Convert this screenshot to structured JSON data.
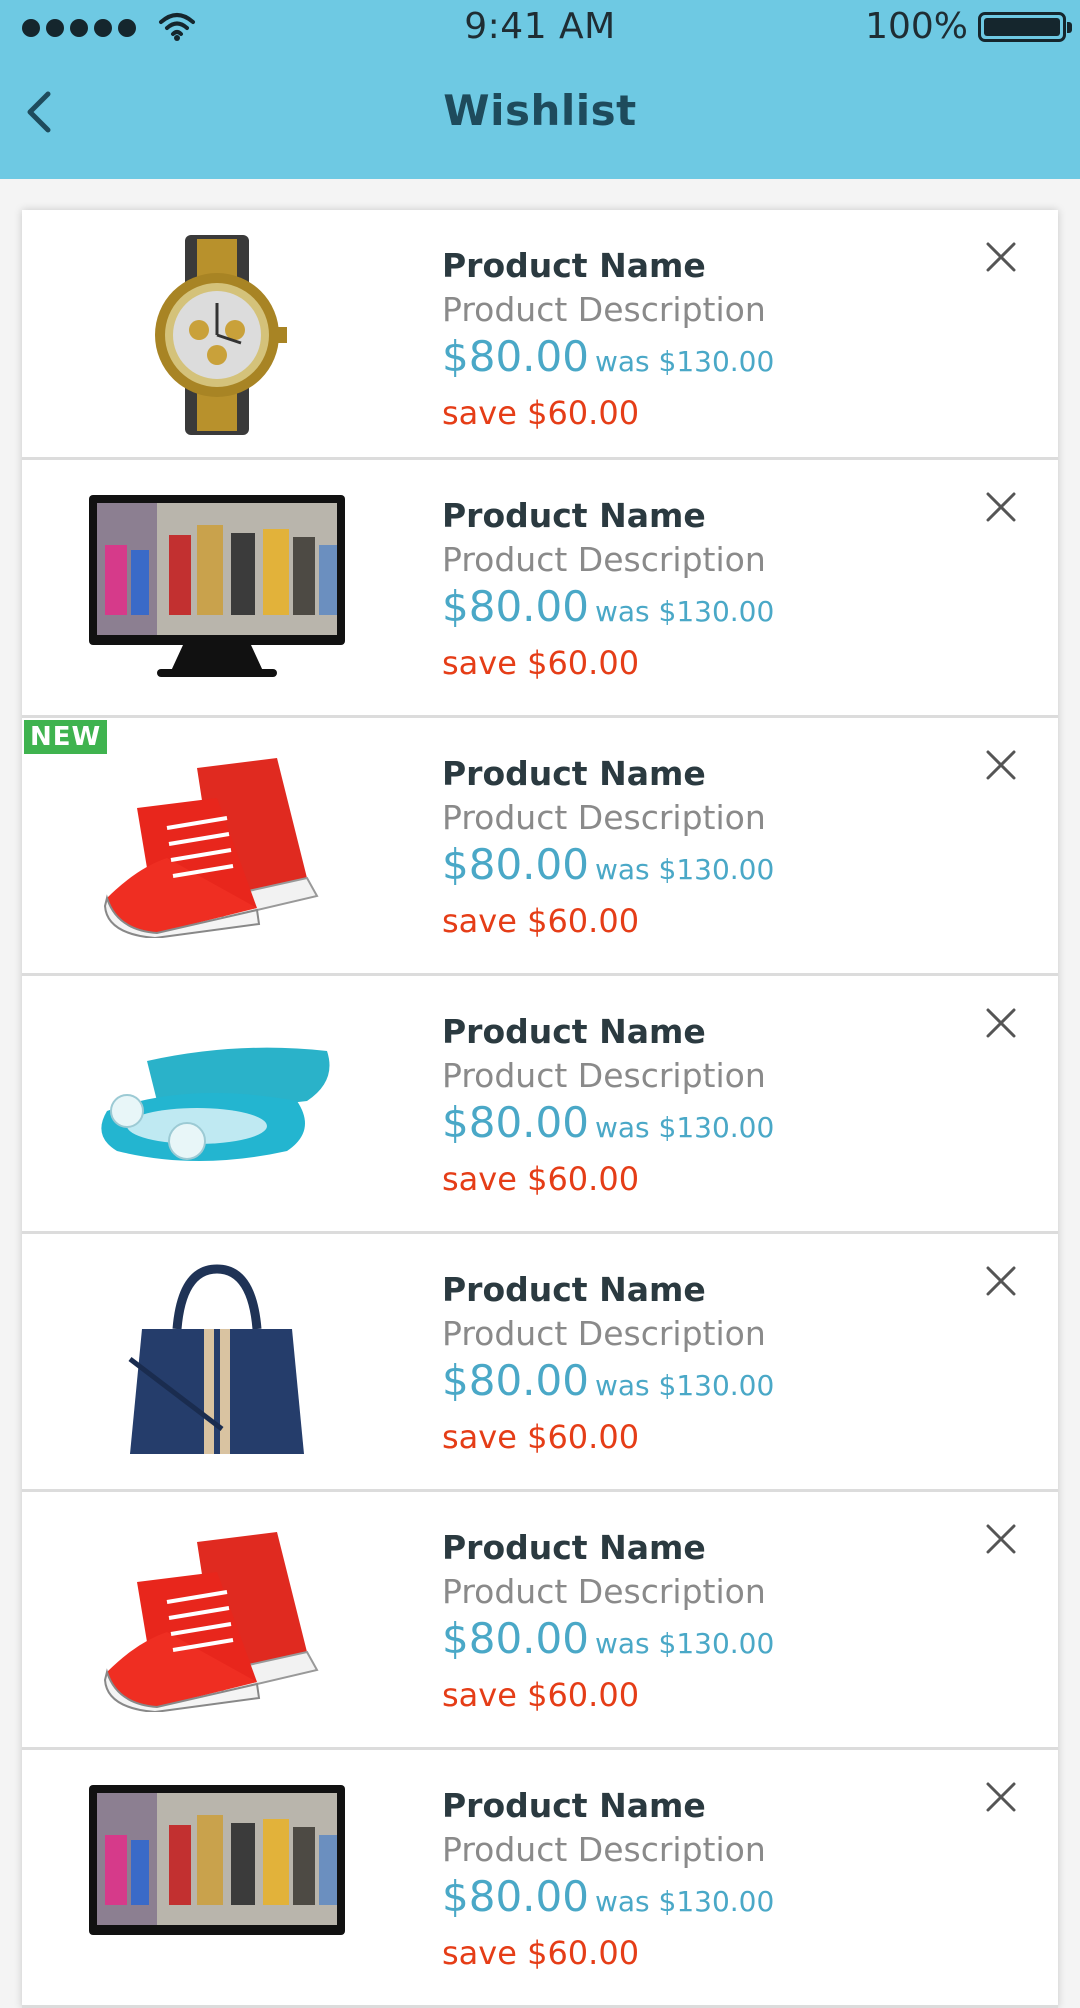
{
  "status_bar": {
    "time": "9:41 AM",
    "battery": "100%"
  },
  "header": {
    "title": "Wishlist"
  },
  "colors": {
    "accent": "#6ec9e3",
    "price": "#4aa8c7",
    "save": "#e53d17",
    "badge": "#3fb34f"
  },
  "items": [
    {
      "image": "watch-image",
      "name": "Product Name",
      "description": "Product Description",
      "price": "$80.00",
      "was": "was $130.00",
      "save": "save $60.00",
      "badge": ""
    },
    {
      "image": "monitor-image",
      "name": "Product Name",
      "description": "Product Description",
      "price": "$80.00",
      "was": "was $130.00",
      "save": "save $60.00",
      "badge": ""
    },
    {
      "image": "red-sneakers-image",
      "name": "Product Name",
      "description": "Product Description",
      "price": "$80.00",
      "was": "was $130.00",
      "save": "save $60.00",
      "badge": "NEW"
    },
    {
      "image": "blue-flats-image",
      "name": "Product Name",
      "description": "Product Description",
      "price": "$80.00",
      "was": "was $130.00",
      "save": "save $60.00",
      "badge": ""
    },
    {
      "image": "handbag-image",
      "name": "Product Name",
      "description": "Product Description",
      "price": "$80.00",
      "was": "was $130.00",
      "save": "save $60.00",
      "badge": ""
    },
    {
      "image": "red-sneakers-image",
      "name": "Product Name",
      "description": "Product Description",
      "price": "$80.00",
      "was": "was $130.00",
      "save": "save $60.00",
      "badge": ""
    },
    {
      "image": "monitor-image",
      "name": "Product Name",
      "description": "Product Description",
      "price": "$80.00",
      "was": "was $130.00",
      "save": "save $60.00",
      "badge": ""
    }
  ]
}
